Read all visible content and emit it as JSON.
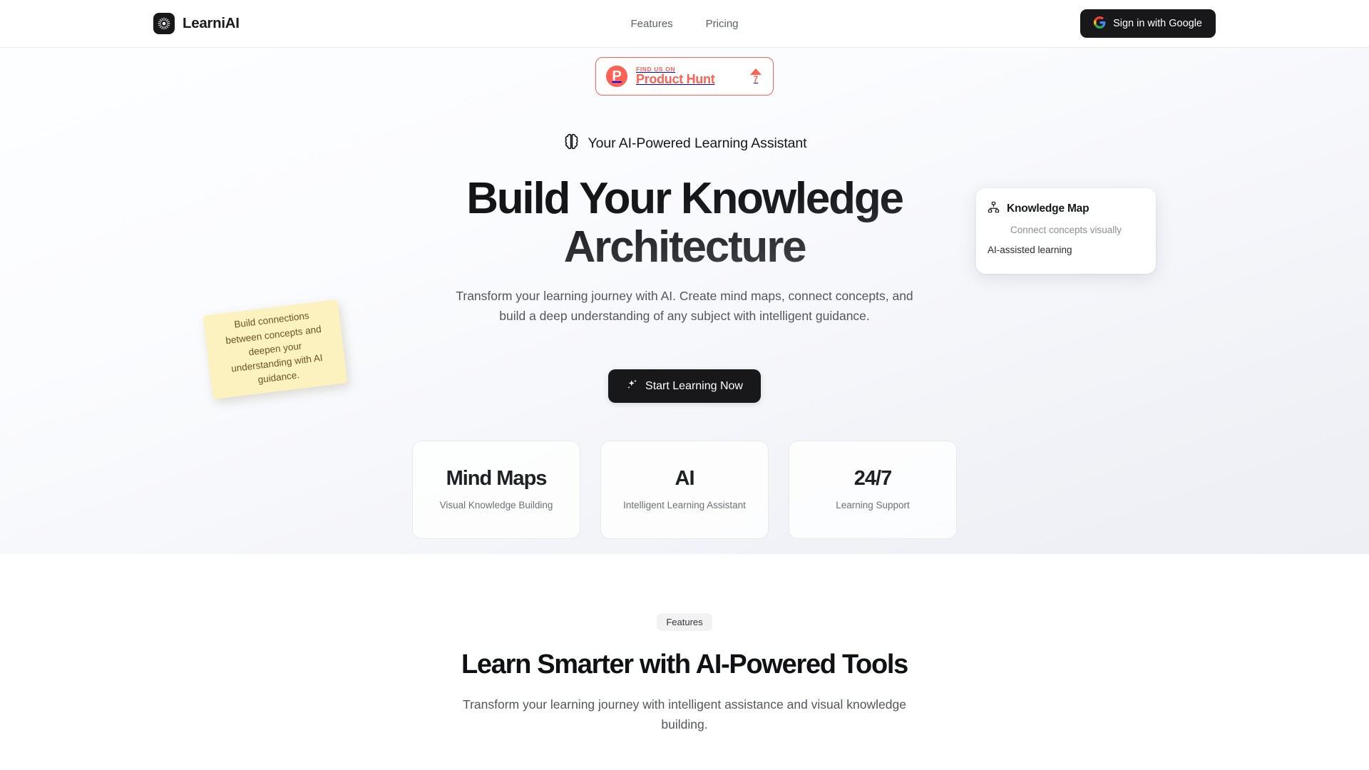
{
  "brand": {
    "name": "LearniAI",
    "logo_icon": "sunburst-sparkle-icon"
  },
  "nav": {
    "links": [
      {
        "label": "Features"
      },
      {
        "label": "Pricing"
      }
    ],
    "auth_button": {
      "label": "Sign in with Google",
      "icon": "google-g-icon"
    }
  },
  "hero": {
    "product_hunt": {
      "kicker": "FIND US ON",
      "name": "Product Hunt",
      "logo_letter": "P",
      "upvote_count": "7",
      "accent_color": "#ff6154"
    },
    "tagline": {
      "icon": "brain-icon",
      "text": "Your AI-Powered Learning Assistant"
    },
    "title_line1": "Build Your Knowledge",
    "title_line2": "Architecture",
    "subtitle": "Transform your learning journey with AI. Create mind maps, connect concepts, and build a deep understanding of any subject with intelligent guidance.",
    "cta": {
      "label": "Start Learning Now",
      "icon": "sparkles-icon"
    },
    "sticky_note": {
      "text": "Build connections between concepts and deepen your understanding with AI guidance.",
      "color": "#fbf2c0"
    },
    "knowledge_card": {
      "icon": "network-hierarchy-icon",
      "title": "Knowledge Map",
      "subtitle": "Connect concepts visually",
      "footer": "AI-assisted learning"
    },
    "stats": [
      {
        "value": "Mind Maps",
        "label": "Visual Knowledge Building"
      },
      {
        "value": "AI",
        "label": "Intelligent Learning Assistant"
      },
      {
        "value": "24/7",
        "label": "Learning Support"
      }
    ]
  },
  "features": {
    "pill": "Features",
    "title": "Learn Smarter with AI-Powered Tools",
    "subtitle": "Transform your learning journey with intelligent assistance and visual knowledge building."
  }
}
